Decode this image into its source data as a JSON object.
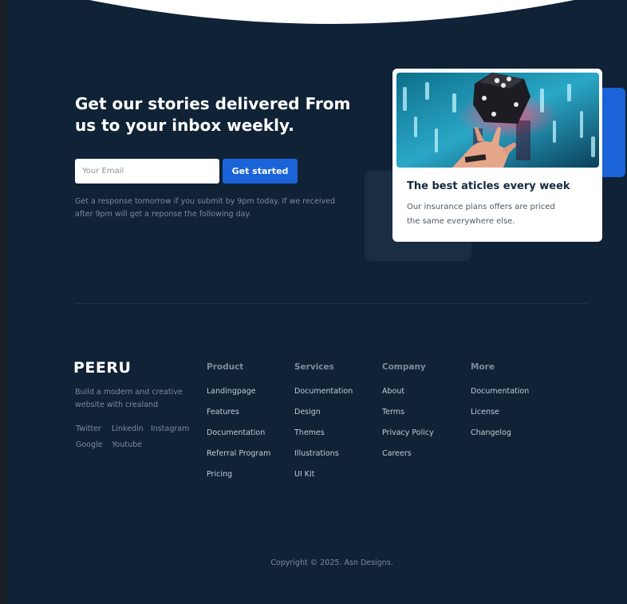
{
  "newsletter": {
    "headline": "Get our stories delivered From us to your inbox weekly.",
    "email_placeholder": "Your Email",
    "button_label": "Get started",
    "note": "Get a response tomorrow if you submit by 9pm today. If we received after 9pm will get a reponse the following day."
  },
  "card": {
    "image_alt": "hand tossing a die in front of blurred neon lights",
    "title": "The best aticles every week",
    "text": "Our insurance plans offers are priced the same everywhere else."
  },
  "footer": {
    "logo": "PEERU",
    "tagline": "Build a modern and creative website with crealand",
    "social": [
      "Twitter",
      "Linkedin",
      "Instagram",
      "Google",
      "Youtube"
    ],
    "columns": [
      {
        "heading": "Product",
        "links": [
          "Landingpage",
          "Features",
          "Documentation",
          "Referral Program",
          "Pricing"
        ]
      },
      {
        "heading": "Services",
        "links": [
          "Documentation",
          "Design",
          "Themes",
          "Illustrations",
          "UI Kit"
        ]
      },
      {
        "heading": "Company",
        "links": [
          "About",
          "Terms",
          "Privacy Policy",
          "Careers"
        ]
      },
      {
        "heading": "More",
        "links": [
          "Documentation",
          "License",
          "Changelog"
        ]
      }
    ],
    "copyright": "Copyright © 2025. Asn Designs."
  },
  "colors": {
    "background": "#0f2236",
    "accent": "#1b63d8",
    "card": "#ffffff",
    "heading_text": "#ffffff",
    "muted_text": "#7d8b9a"
  }
}
